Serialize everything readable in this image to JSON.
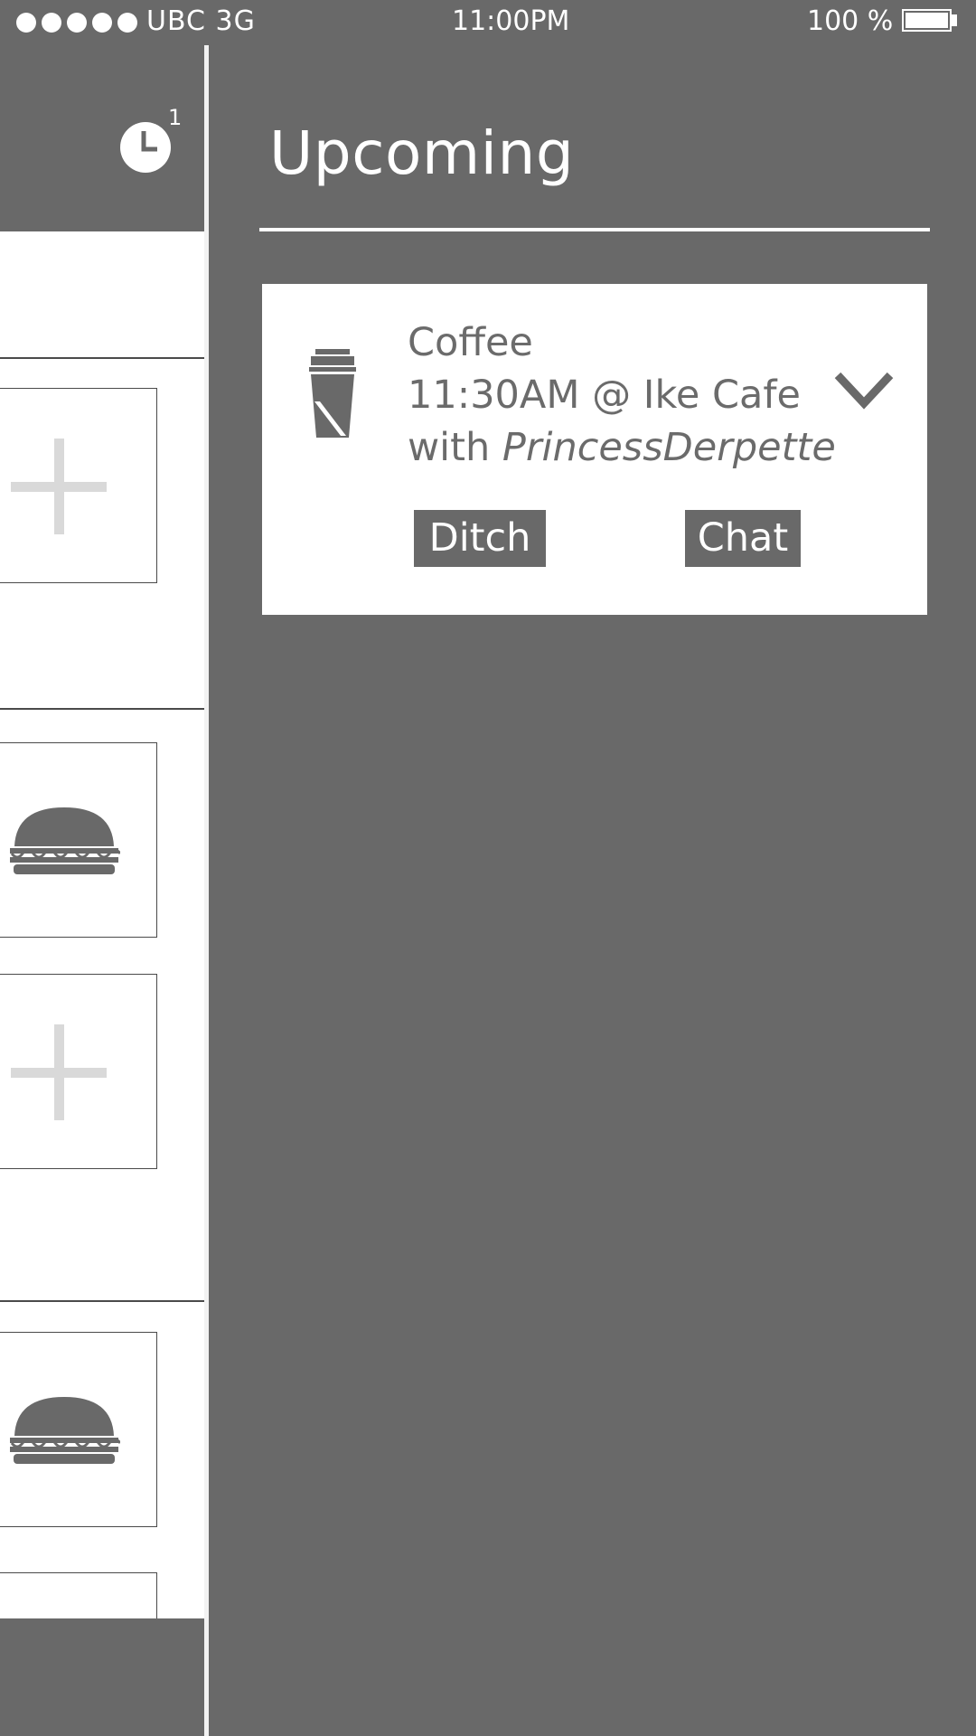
{
  "status_bar": {
    "carrier": "UBC  3G",
    "time": "11:00PM",
    "battery": "100 %",
    "signal_dots": 5
  },
  "left_panel": {
    "history_badge": "1",
    "tiles": [
      {
        "icon": "plus-icon"
      },
      {
        "icon": "burger-icon"
      },
      {
        "icon": "plus-icon"
      },
      {
        "icon": "burger-icon"
      }
    ]
  },
  "drawer": {
    "title": "Upcoming",
    "events": [
      {
        "icon": "coffee-cup-icon",
        "activity": "Coffee",
        "time_place": "11:30AM @ Ike Cafe",
        "with_prefix": "with ",
        "person": "PrincessDerpette",
        "ditch_label": "Ditch",
        "chat_label": "Chat"
      }
    ]
  },
  "colors": {
    "panel_gray": "#696969",
    "text_gray": "#6b6b6b",
    "white": "#ffffff",
    "placeholder_plus": "#d9d9d9"
  }
}
